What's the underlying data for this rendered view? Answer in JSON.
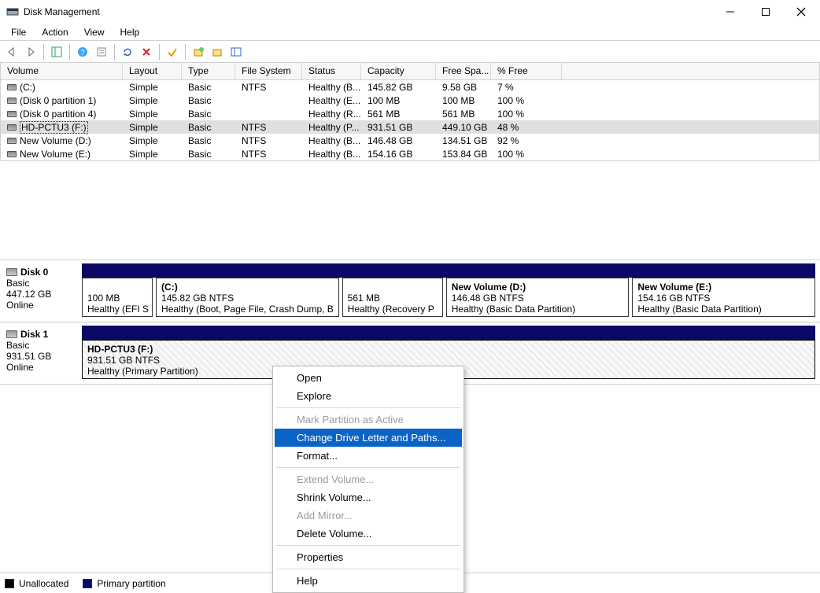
{
  "window": {
    "title": "Disk Management"
  },
  "menu": {
    "file": "File",
    "action": "Action",
    "view": "View",
    "help": "Help"
  },
  "columns": {
    "volume": "Volume",
    "layout": "Layout",
    "type": "Type",
    "filesystem": "File System",
    "status": "Status",
    "capacity": "Capacity",
    "freespace": "Free Spa...",
    "pctfree": "% Free"
  },
  "volumes": [
    {
      "name": "(C:)",
      "layout": "Simple",
      "type": "Basic",
      "fs": "NTFS",
      "status": "Healthy (B...",
      "capacity": "145.82 GB",
      "free": "9.58 GB",
      "pct": "7 %",
      "selected": false
    },
    {
      "name": "(Disk 0 partition 1)",
      "layout": "Simple",
      "type": "Basic",
      "fs": "",
      "status": "Healthy (E...",
      "capacity": "100 MB",
      "free": "100 MB",
      "pct": "100 %",
      "selected": false
    },
    {
      "name": "(Disk 0 partition 4)",
      "layout": "Simple",
      "type": "Basic",
      "fs": "",
      "status": "Healthy (R...",
      "capacity": "561 MB",
      "free": "561 MB",
      "pct": "100 %",
      "selected": false
    },
    {
      "name": "HD-PCTU3 (F:)",
      "layout": "Simple",
      "type": "Basic",
      "fs": "NTFS",
      "status": "Healthy (P...",
      "capacity": "931.51 GB",
      "free": "449.10 GB",
      "pct": "48 %",
      "selected": true
    },
    {
      "name": "New Volume (D:)",
      "layout": "Simple",
      "type": "Basic",
      "fs": "NTFS",
      "status": "Healthy (B...",
      "capacity": "146.48 GB",
      "free": "134.51 GB",
      "pct": "92 %",
      "selected": false
    },
    {
      "name": "New Volume (E:)",
      "layout": "Simple",
      "type": "Basic",
      "fs": "NTFS",
      "status": "Healthy (B...",
      "capacity": "154.16 GB",
      "free": "153.84 GB",
      "pct": "100 %",
      "selected": false
    }
  ],
  "disks": [
    {
      "name": "Disk 0",
      "type": "Basic",
      "size": "447.12 GB",
      "status": "Online",
      "partitions": [
        {
          "title": "",
          "line2": "100 MB",
          "line3": "Healthy (EFI S",
          "flex": 8
        },
        {
          "title": "(C:)",
          "line2": "145.82 GB NTFS",
          "line3": "Healthy (Boot, Page File, Crash Dump, B",
          "flex": 23
        },
        {
          "title": "",
          "line2": "561 MB",
          "line3": "Healthy (Recovery P",
          "flex": 12
        },
        {
          "title": "New Volume  (D:)",
          "line2": "146.48 GB NTFS",
          "line3": "Healthy (Basic Data Partition)",
          "flex": 23
        },
        {
          "title": "New Volume  (E:)",
          "line2": "154.16 GB NTFS",
          "line3": "Healthy (Basic Data Partition)",
          "flex": 23
        }
      ]
    },
    {
      "name": "Disk 1",
      "type": "Basic",
      "size": "931.51 GB",
      "status": "Online",
      "partitions": [
        {
          "title": "HD-PCTU3  (F:)",
          "line2": "931.51 GB NTFS",
          "line3": "Healthy (Primary Partition)",
          "flex": 100,
          "selected": true
        }
      ]
    }
  ],
  "legend": {
    "unallocated": "Unallocated",
    "primary": "Primary partition"
  },
  "context_menu": [
    {
      "label": "Open",
      "state": "normal"
    },
    {
      "label": "Explore",
      "state": "normal"
    },
    {
      "sep": true
    },
    {
      "label": "Mark Partition as Active",
      "state": "disabled"
    },
    {
      "label": "Change Drive Letter and Paths...",
      "state": "hover"
    },
    {
      "label": "Format...",
      "state": "normal"
    },
    {
      "sep": true
    },
    {
      "label": "Extend Volume...",
      "state": "disabled"
    },
    {
      "label": "Shrink Volume...",
      "state": "normal"
    },
    {
      "label": "Add Mirror...",
      "state": "disabled"
    },
    {
      "label": "Delete Volume...",
      "state": "normal"
    },
    {
      "sep": true
    },
    {
      "label": "Properties",
      "state": "normal"
    },
    {
      "sep": true
    },
    {
      "label": "Help",
      "state": "normal"
    }
  ]
}
